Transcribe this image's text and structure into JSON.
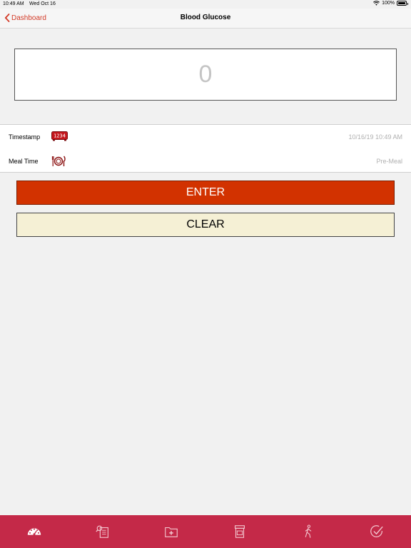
{
  "status_bar": {
    "time": "10:49 AM",
    "date": "Wed Oct 16",
    "battery": "100%"
  },
  "nav": {
    "back_label": "Dashboard",
    "title": "Blood Glucose"
  },
  "reading": {
    "value": "0"
  },
  "info": {
    "timestamp_label": "Timestamp",
    "timestamp_icon_text": "1234",
    "timestamp_value": "10/16/19 10:49 AM",
    "meal_label": "Meal Time",
    "meal_value": "Pre-Meal"
  },
  "buttons": {
    "enter": "ENTER",
    "clear": "CLEAR"
  },
  "tabs": [
    {
      "icon": "gauge-icon"
    },
    {
      "icon": "document-search-icon"
    },
    {
      "icon": "medical-folder-icon"
    },
    {
      "icon": "prescription-bottle-icon"
    },
    {
      "icon": "walking-person-icon"
    },
    {
      "icon": "checkmark-circle-icon"
    }
  ],
  "colors": {
    "accent": "#d33a27",
    "enter_bg": "#d23200",
    "clear_bg": "#f5f0d5",
    "tab_bar_bg": "#c42948"
  }
}
